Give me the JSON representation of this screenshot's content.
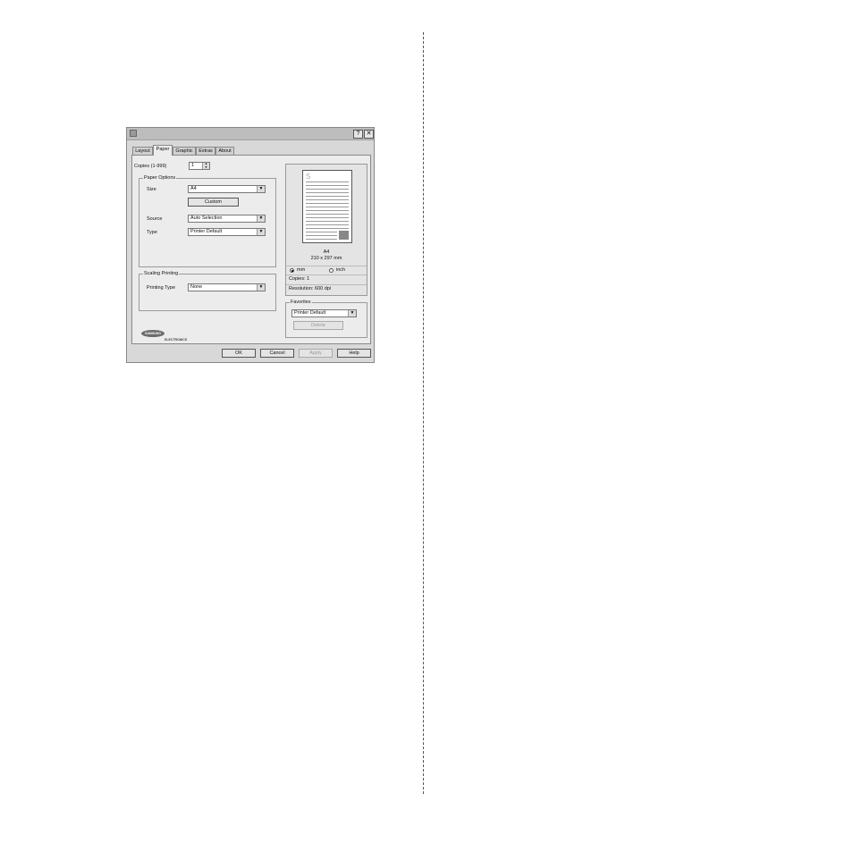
{
  "window": {
    "help_label": "?",
    "close_label": "✕"
  },
  "tabs": [
    "Layout",
    "Paper",
    "Graphic",
    "Extras",
    "About"
  ],
  "copies": {
    "label": "Copies (1-999)",
    "value": "1"
  },
  "paper_options": {
    "group_label": "Paper Options",
    "size_label": "Size",
    "size_value": "A4",
    "custom_button": "Custom",
    "source_label": "Source",
    "source_value": "Auto Selection",
    "type_label": "Type",
    "type_value": "Printer Default"
  },
  "scaling": {
    "group_label": "Scaling Printing",
    "printing_type_label": "Printing Type",
    "printing_type_value": "None"
  },
  "preview": {
    "page_letter": "S",
    "paper_name": "A4",
    "paper_dims": "210 x 297 mm",
    "unit_mm": "mm",
    "unit_inch": "inch",
    "selected_unit": "mm",
    "copies_text": "Copies: 1",
    "resolution_text": "Resolution: 600 dpi"
  },
  "favorites": {
    "group_label": "Favorites",
    "value": "Printer Default",
    "delete_button": "Delete"
  },
  "logo": {
    "brand": "SAMSUNG",
    "sub": "ELECTRONICS"
  },
  "buttons": {
    "ok": "OK",
    "cancel": "Cancel",
    "apply": "Apply",
    "help": "Help"
  },
  "icons": {
    "arrow": "▼",
    "spin_up": "▲",
    "spin_down": "▼"
  }
}
